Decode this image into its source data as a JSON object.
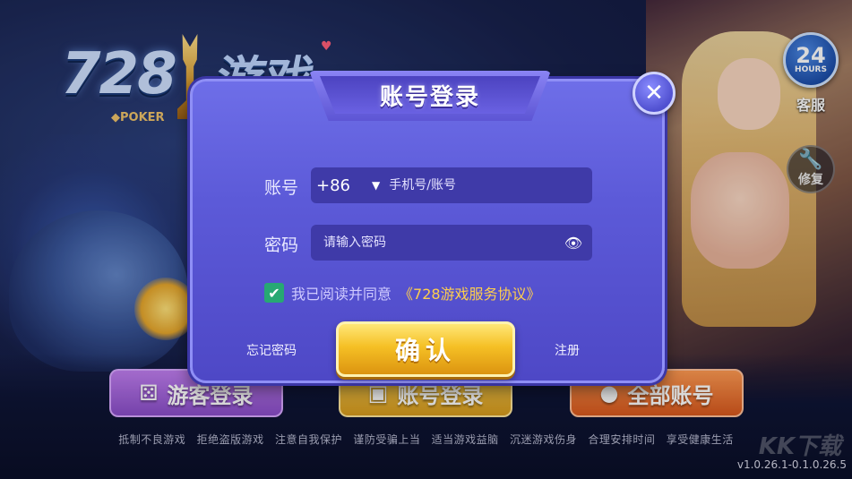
{
  "logo": {
    "number": "728",
    "game_text": "游戏",
    "poker": "◆POKER",
    "heart": "♥"
  },
  "service": {
    "number": "24",
    "hours": "HOURS",
    "label": "客服"
  },
  "repair": {
    "glyph": "🔧",
    "label": "修复"
  },
  "bottom_buttons": {
    "guest": {
      "label": "游客登录",
      "icon": "dice-icon"
    },
    "account": {
      "label": "账号登录",
      "icon": "card-icon"
    },
    "all": {
      "label": "全部账号",
      "icon": "user-icon"
    }
  },
  "tips": [
    "抵制不良游戏",
    "拒绝盗版游戏",
    "注意自我保护",
    "谨防受骗上当",
    "适当游戏益脑",
    "沉迷游戏伤身",
    "合理安排时间",
    "享受健康生活"
  ],
  "version": "v1.0.26.1-0.1.0.26.5",
  "watermark": "KK下载",
  "dialog": {
    "title": "账号登录",
    "close": "✕",
    "account_label": "账号",
    "country_code": "+86",
    "dropdown_arrow": "▼",
    "account_placeholder": "手机号/账号",
    "password_label": "密码",
    "password_placeholder": "请输入密码",
    "eye": "👁",
    "agree_check": "✔",
    "agree_text": "我已阅读并同意",
    "agree_link": "《728游戏服务协议》",
    "forgot": "忘记密码",
    "confirm": "确认",
    "register": "注册"
  },
  "colors": {
    "dialog": "#5c5ad8",
    "field": "#3f3aa8",
    "confirm": "#f5c025",
    "link": "#ffcf4d",
    "checkbox": "#27a873"
  }
}
